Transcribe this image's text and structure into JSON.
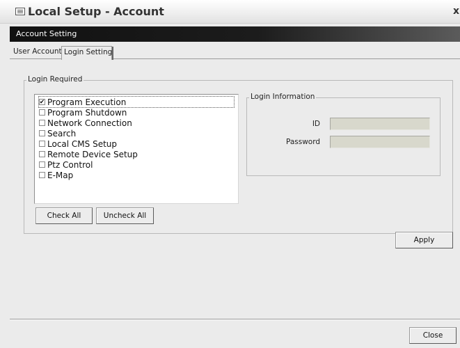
{
  "window": {
    "title": "Local Setup - Account",
    "close_glyph": "x",
    "icon": "window-icon"
  },
  "section_header": "Account Setting",
  "tabs": [
    {
      "label": "User Account",
      "active": false
    },
    {
      "label": "Login Setting",
      "active": true
    }
  ],
  "login_required": {
    "title": "Login Required",
    "items": [
      {
        "label": "Program Execution",
        "checked": true
      },
      {
        "label": "Program Shutdown",
        "checked": false
      },
      {
        "label": "Network Connection",
        "checked": false
      },
      {
        "label": "Search",
        "checked": false
      },
      {
        "label": "Local CMS Setup",
        "checked": false
      },
      {
        "label": "Remote Device Setup",
        "checked": false
      },
      {
        "label": "Ptz Control",
        "checked": false
      },
      {
        "label": "E-Map",
        "checked": false
      }
    ],
    "check_all_label": "Check All",
    "uncheck_all_label": "Uncheck All"
  },
  "login_information": {
    "title": "Login Information",
    "id_label": "ID",
    "id_value": "",
    "password_label": "Password",
    "password_value": ""
  },
  "apply_label": "Apply",
  "close_label": "Close",
  "check_mark": "✔"
}
